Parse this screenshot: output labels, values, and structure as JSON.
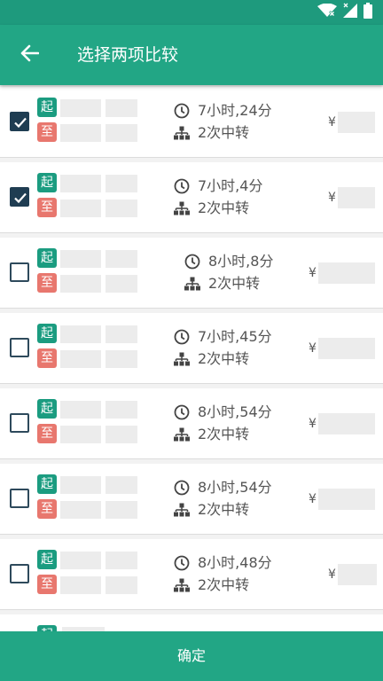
{
  "header": {
    "title": "选择两项比较"
  },
  "tags": {
    "from": "起",
    "to": "至"
  },
  "currency": "¥",
  "confirm_label": "确定",
  "colors": {
    "primary": "#22a685",
    "status_bar": "#1e9a7d",
    "from_tag": "#1b9c80",
    "to_tag": "#e8776e",
    "checkbox": "#1f3d52"
  },
  "options": [
    {
      "duration": "7小时,24分",
      "transfers": "2次中转",
      "checked": true
    },
    {
      "duration": "7小时,4分",
      "transfers": "2次中转",
      "checked": true
    },
    {
      "duration": "8小时,8分",
      "transfers": "2次中转",
      "checked": false
    },
    {
      "duration": "7小时,45分",
      "transfers": "2次中转",
      "checked": false
    },
    {
      "duration": "8小时,54分",
      "transfers": "2次中转",
      "checked": false
    },
    {
      "duration": "8小时,54分",
      "transfers": "2次中转",
      "checked": false
    },
    {
      "duration": "8小时,48分",
      "transfers": "2次中转",
      "checked": false
    }
  ]
}
